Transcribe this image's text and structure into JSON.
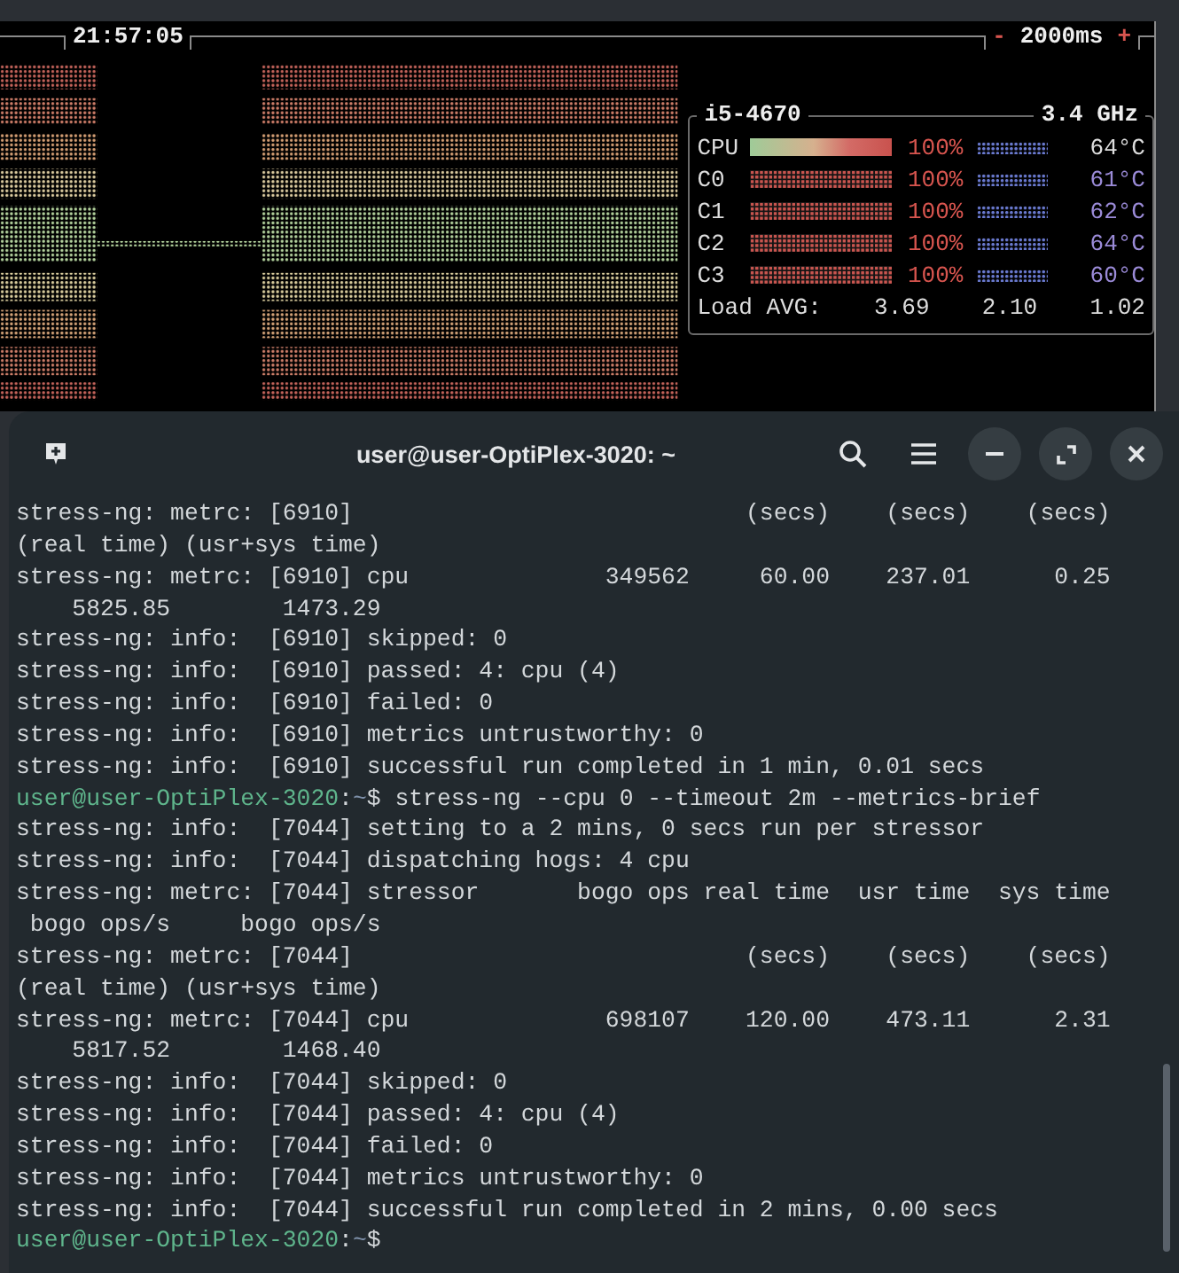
{
  "monitor": {
    "clock": "21:57:05",
    "interval": {
      "decrease": "-",
      "value": "2000ms",
      "increase": "+"
    },
    "cpu_panel": {
      "model": "i5-4670",
      "frequency": "3.4 GHz",
      "rows": [
        {
          "kind": "total",
          "label": "CPU",
          "level": 1,
          "percent": "100%",
          "temperature": "64°C"
        },
        {
          "kind": "core",
          "label": "C0",
          "level": 1,
          "percent": "100%",
          "temperature": "61°C"
        },
        {
          "kind": "core",
          "label": "C1",
          "level": 1,
          "percent": "100%",
          "temperature": "62°C"
        },
        {
          "kind": "core",
          "label": "C2",
          "level": 1,
          "percent": "100%",
          "temperature": "64°C"
        },
        {
          "kind": "core",
          "label": "C3",
          "level": 1,
          "percent": "100%",
          "temperature": "60°C"
        }
      ],
      "load_avg": {
        "label": "Load AVG:",
        "values": [
          "3.69",
          "2.10",
          "1.02"
        ]
      }
    }
  },
  "terminal": {
    "title": "user@user-OptiPlex-3020: ~",
    "lines": [
      {
        "kind": "output",
        "text": "stress-ng: metrc: [6910]                            (secs)    (secs)    (secs)"
      },
      {
        "kind": "output",
        "text": "(real time) (usr+sys time)"
      },
      {
        "kind": "output",
        "text": "stress-ng: metrc: [6910] cpu              349562     60.00    237.01      0.25"
      },
      {
        "kind": "output",
        "text": "    5825.85        1473.29"
      },
      {
        "kind": "output",
        "text": "stress-ng: info:  [6910] skipped: 0"
      },
      {
        "kind": "output",
        "text": "stress-ng: info:  [6910] passed: 4: cpu (4)"
      },
      {
        "kind": "output",
        "text": "stress-ng: info:  [6910] failed: 0"
      },
      {
        "kind": "output",
        "text": "stress-ng: info:  [6910] metrics untrustworthy: 0"
      },
      {
        "kind": "output",
        "text": "stress-ng: info:  [6910] successful run completed in 1 min, 0.01 secs"
      },
      {
        "kind": "prompt",
        "user_host": "user@user-OptiPlex-3020",
        "separator": ":",
        "path": "~",
        "symbol": "$",
        "command": "stress-ng --cpu 0 --timeout 2m --metrics-brief"
      },
      {
        "kind": "output",
        "text": "stress-ng: info:  [7044] setting to a 2 mins, 0 secs run per stressor"
      },
      {
        "kind": "output",
        "text": "stress-ng: info:  [7044] dispatching hogs: 4 cpu"
      },
      {
        "kind": "output",
        "text": "stress-ng: metrc: [7044] stressor       bogo ops real time  usr time  sys time"
      },
      {
        "kind": "output",
        "text": " bogo ops/s     bogo ops/s"
      },
      {
        "kind": "output",
        "text": "stress-ng: metrc: [7044]                            (secs)    (secs)    (secs)"
      },
      {
        "kind": "output",
        "text": "(real time) (usr+sys time)"
      },
      {
        "kind": "output",
        "text": "stress-ng: metrc: [7044] cpu              698107    120.00    473.11      2.31"
      },
      {
        "kind": "output",
        "text": "    5817.52        1468.40"
      },
      {
        "kind": "output",
        "text": "stress-ng: info:  [7044] skipped: 0"
      },
      {
        "kind": "output",
        "text": "stress-ng: info:  [7044] passed: 4: cpu (4)"
      },
      {
        "kind": "output",
        "text": "stress-ng: info:  [7044] failed: 0"
      },
      {
        "kind": "output",
        "text": "stress-ng: info:  [7044] metrics untrustworthy: 0"
      },
      {
        "kind": "output",
        "text": "stress-ng: info:  [7044] successful run completed in 2 mins, 0.00 secs"
      },
      {
        "kind": "prompt",
        "user_host": "user@user-OptiPlex-3020",
        "separator": ":",
        "path": "~",
        "symbol": "$"
      }
    ]
  }
}
